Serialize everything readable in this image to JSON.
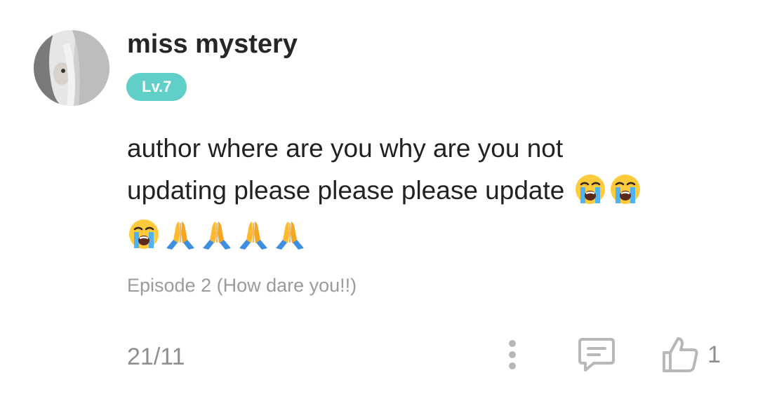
{
  "comment": {
    "username": "miss mystery",
    "level_badge": "Lv.7",
    "text_line1": "author where are you why are you not",
    "text_line2": "updating please please please update",
    "emoji": {
      "crying": "loudly-crying-face-emoji",
      "praying": "folded-hands-emoji"
    },
    "episode": "Episode 2 (How dare you!!)",
    "date": "21/11",
    "like_count": "1"
  },
  "colors": {
    "badge": "#5fcfc8",
    "username": "#262626",
    "body_text": "#222222",
    "meta_text": "#9b9b9b",
    "icon": "#b8b8b8"
  },
  "icons": {
    "more": "more-vertical-icon",
    "reply": "comment-icon",
    "like": "thumbs-up-icon"
  }
}
